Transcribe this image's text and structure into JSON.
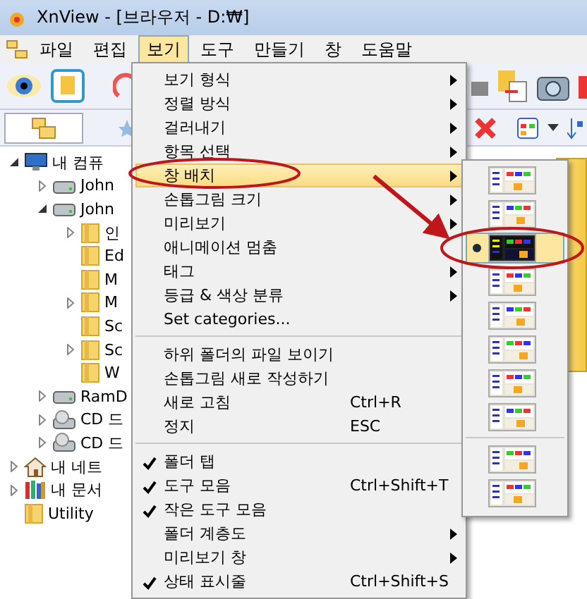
{
  "window": {
    "title": "XnView - [브라우저 - D:₩]"
  },
  "menubar": [
    {
      "label": "파일",
      "selected": false
    },
    {
      "label": "편집",
      "selected": false
    },
    {
      "label": "보기",
      "selected": true
    },
    {
      "label": "도구",
      "selected": false
    },
    {
      "label": "만들기",
      "selected": false
    },
    {
      "label": "창",
      "selected": false
    },
    {
      "label": "도움말",
      "selected": false
    }
  ],
  "tree": [
    {
      "label": "내 컴퓨",
      "kind": "computer",
      "expandable": true,
      "expanded": true,
      "children": [
        {
          "label": "John",
          "kind": "drive",
          "expandable": true,
          "expanded": false
        },
        {
          "label": "John",
          "kind": "drive",
          "expandable": true,
          "expanded": true,
          "children": [
            {
              "label": "인",
              "kind": "folder",
              "expandable": true,
              "expanded": false
            },
            {
              "label": "Ed",
              "kind": "folder",
              "expandable": false
            },
            {
              "label": "M",
              "kind": "folder",
              "expandable": false
            },
            {
              "label": "M",
              "kind": "folder",
              "expandable": true,
              "expanded": false
            },
            {
              "label": "Sc",
              "kind": "folder",
              "expandable": false
            },
            {
              "label": "Sc",
              "kind": "folder",
              "expandable": true,
              "expanded": false
            },
            {
              "label": "W",
              "kind": "folder",
              "expandable": false
            }
          ]
        },
        {
          "label": "RamD",
          "kind": "drive",
          "expandable": true,
          "expanded": false
        },
        {
          "label": "CD 드",
          "kind": "cd",
          "expandable": true,
          "expanded": false
        },
        {
          "label": "CD 드",
          "kind": "cd",
          "expandable": true,
          "expanded": false
        }
      ]
    },
    {
      "label": "내 네트",
      "kind": "network",
      "expandable": true,
      "expanded": false
    },
    {
      "label": "내 문서",
      "kind": "documents",
      "expandable": true,
      "expanded": false
    },
    {
      "label": "Utility",
      "kind": "folder",
      "expandable": false
    }
  ],
  "menu": [
    {
      "kind": "item",
      "label": "보기 형식",
      "submenu": true,
      "checked": false,
      "highlighted": false
    },
    {
      "kind": "item",
      "label": "정렬 방식",
      "submenu": true,
      "checked": false,
      "highlighted": false
    },
    {
      "kind": "item",
      "label": "걸러내기",
      "submenu": true,
      "checked": false,
      "highlighted": false
    },
    {
      "kind": "item",
      "label": "항목 선택",
      "submenu": true,
      "checked": false,
      "highlighted": false
    },
    {
      "kind": "item",
      "label": "창 배치",
      "submenu": true,
      "checked": false,
      "highlighted": true
    },
    {
      "kind": "item",
      "label": "손톱그림 크기",
      "submenu": true,
      "checked": false,
      "highlighted": false
    },
    {
      "kind": "item",
      "label": "미리보기",
      "submenu": true,
      "checked": false,
      "highlighted": false
    },
    {
      "kind": "item",
      "label": "애니메이션 멈춤",
      "submenu": false,
      "checked": false,
      "highlighted": false
    },
    {
      "kind": "item",
      "label": "태그",
      "submenu": true,
      "checked": false,
      "highlighted": false
    },
    {
      "kind": "item",
      "label": "등급 & 색상 분류",
      "submenu": true,
      "checked": false,
      "highlighted": false
    },
    {
      "kind": "item",
      "label": "Set categories...",
      "submenu": false,
      "checked": false,
      "highlighted": false
    },
    {
      "kind": "separator"
    },
    {
      "kind": "item",
      "label": "하위 폴더의 파일 보이기",
      "submenu": false,
      "checked": false,
      "highlighted": false
    },
    {
      "kind": "item",
      "label": "손톱그림 새로 작성하기",
      "submenu": false,
      "checked": false,
      "highlighted": false
    },
    {
      "kind": "item",
      "label": "새로 고침",
      "shortcut": "Ctrl+R",
      "submenu": false,
      "checked": false,
      "highlighted": false
    },
    {
      "kind": "item",
      "label": "정지",
      "shortcut": "ESC",
      "submenu": false,
      "checked": false,
      "highlighted": false
    },
    {
      "kind": "separator"
    },
    {
      "kind": "item",
      "label": "폴더 탭",
      "submenu": false,
      "checked": true,
      "highlighted": false
    },
    {
      "kind": "item",
      "label": "도구 모음",
      "shortcut": "Ctrl+Shift+T",
      "submenu": false,
      "checked": true,
      "highlighted": false
    },
    {
      "kind": "item",
      "label": "작은 도구 모음",
      "submenu": false,
      "checked": true,
      "highlighted": false
    },
    {
      "kind": "item",
      "label": "폴더 계층도",
      "submenu": true,
      "checked": false,
      "highlighted": false
    },
    {
      "kind": "item",
      "label": "미리보기 창",
      "submenu": true,
      "checked": false,
      "highlighted": false
    },
    {
      "kind": "item",
      "label": "상태 표시줄",
      "shortcut": "Ctrl+Shift+S",
      "submenu": false,
      "checked": true,
      "highlighted": false
    }
  ],
  "layout_submenu": [
    {
      "kind": "item",
      "selected": false
    },
    {
      "kind": "item",
      "selected": false
    },
    {
      "kind": "item",
      "selected": true
    },
    {
      "kind": "item",
      "selected": false
    },
    {
      "kind": "item",
      "selected": false
    },
    {
      "kind": "item",
      "selected": false
    },
    {
      "kind": "item",
      "selected": false
    },
    {
      "kind": "item",
      "selected": false
    },
    {
      "kind": "separator"
    },
    {
      "kind": "item",
      "selected": false
    },
    {
      "kind": "item",
      "selected": false
    }
  ]
}
